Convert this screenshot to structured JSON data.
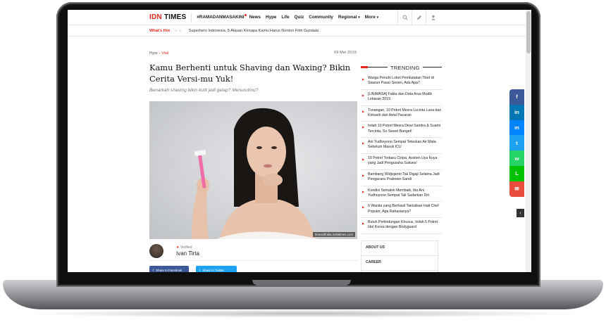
{
  "header": {
    "logo_idn": "IDN",
    "logo_times": "TIMES",
    "nav": [
      "#RAMADANMASAKINI",
      "News",
      "Hype",
      "Life",
      "Quiz",
      "Community",
      "Regional",
      "More"
    ],
    "caret": "▾",
    "icons": [
      "search-icon",
      "pen-icon",
      "user-icon"
    ]
  },
  "hotbar": {
    "label": "What's Hot",
    "prev": "‹",
    "next": "›",
    "headline": "Superhero Indonesia, 5 Alasan Kenapa Kamu Harus Nonton Film Gundala"
  },
  "article": {
    "breadcrumb": [
      "Hype",
      "Viral"
    ],
    "breadcrumb_sep": "›",
    "date": "09 Mei 2019",
    "title": "Kamu Berhenti untuk Shaving dan Waxing? Bikin Cerita Versi-mu Yuk!",
    "subtitle": "Benarkah shaving bikin kulit jadi gelap? Menurutmu?",
    "image_credit": "timesofindia.indiatimes.com",
    "author_badge": "Verified",
    "author_name": "Ivan Tirta",
    "share_facebook": "Share to Facebook",
    "share_twitter": "Share to Twitter"
  },
  "trending": {
    "heading": "TRENDING",
    "items": [
      "Warga Penuhi Loket Pembatalan Tiket di Stasiun Pasar Senen, Ada Apa?",
      "[LINIMASA] Fakta dan Data Arus Mudik Lebaran 2019",
      "Tunangan, 10 Potret Mesra Lucinta Luna dan Kekasih dari Awal Pacaran",
      "Inilah 10 Potret Mesra Dewi Sandra & Suami Tercinta, So Sweet Banget!",
      "Ani Yudhoyono Sempat Teteskan Air Mata Sebelum Masuk ICU",
      "10 Potret Terbaru Ciripa, Asisten Uya Kuya yang Jadi Pengusaha Sukses!",
      "Bambang Widjojanto Tak Digaji Selama Jadi Pengacara Prabowo-Sandi",
      "Kondisi Semakin Membaik, Ibu Ani Yudhoyono Sempat Tali Sadarkan Diri",
      "6 Wanita yang Berhasil Taklukkan Hati Chef Populer, Apa Rahasianya?",
      "Butuh Perlindungan Khusus, Inilah 5 Potret Idol Korea dengan Bodyguard"
    ]
  },
  "side_links": [
    "ABOUT US",
    "CAREER",
    ""
  ],
  "dock": {
    "facebook": "f",
    "linkedin": "in",
    "messenger": "m",
    "twitter": "t",
    "whatsapp": "w",
    "line": "L",
    "email": "✉",
    "collapse": "‹"
  },
  "colors": {
    "brand_red": "#e2261c",
    "facebook": "#3b5998",
    "twitter": "#1da1f2"
  }
}
